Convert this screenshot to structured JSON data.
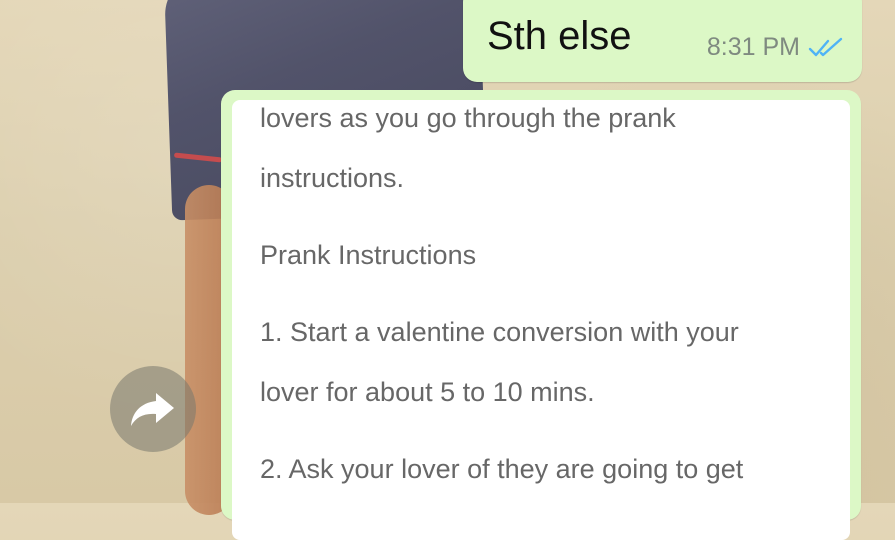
{
  "outgoing_message": {
    "text": "Sth else",
    "time": "8:31 PM",
    "status_icon": "double-check-read-icon"
  },
  "forwarded_message": {
    "lines": [
      "lovers as you go through the prank",
      "instructions.",
      "Prank Instructions",
      "1. Start a valentine conversion with your",
      "lover for about 5 to 10 mins.",
      "2. Ask your lover of they are going to get"
    ]
  },
  "forward_button": {
    "icon": "forward-arrow-icon"
  },
  "colors": {
    "bubble_green": "#dcf8c6",
    "tick_blue": "#4fb3f6",
    "wallpaper": "#dccfae"
  }
}
